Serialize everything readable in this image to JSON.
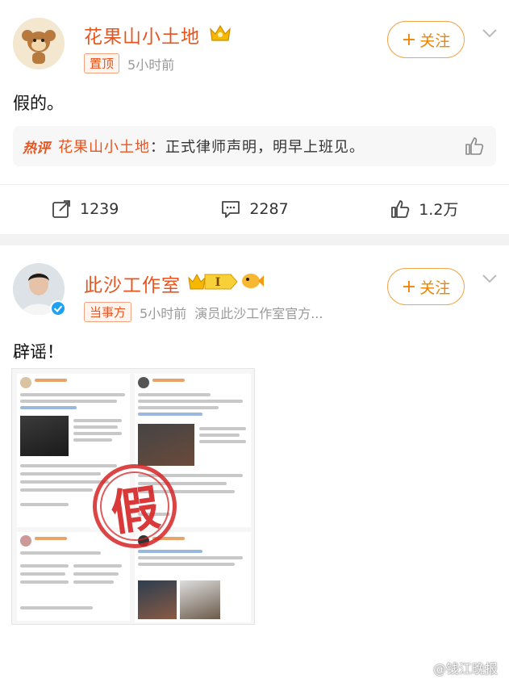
{
  "post1": {
    "author": "花果山小土地",
    "pinned_tag": "置顶",
    "time": "5小时前",
    "follow_label": "关注",
    "text": "假的。",
    "hot_comment": {
      "label": "热评",
      "user": "花果山小土地",
      "text": "：正式律师声明，明早上班见。"
    },
    "actions": {
      "repost": "1239",
      "comments": "2287",
      "likes": "1.2万"
    }
  },
  "post2": {
    "author": "此沙工作室",
    "party_tag": "当事方",
    "time": "5小时前",
    "source": "演员此沙工作室官方...",
    "follow_label": "关注",
    "text": "辟谣！",
    "stamp": "假"
  },
  "watermark": "@钱江晚报",
  "colors": {
    "accent": "#e8541e",
    "follow": "#f08300"
  }
}
